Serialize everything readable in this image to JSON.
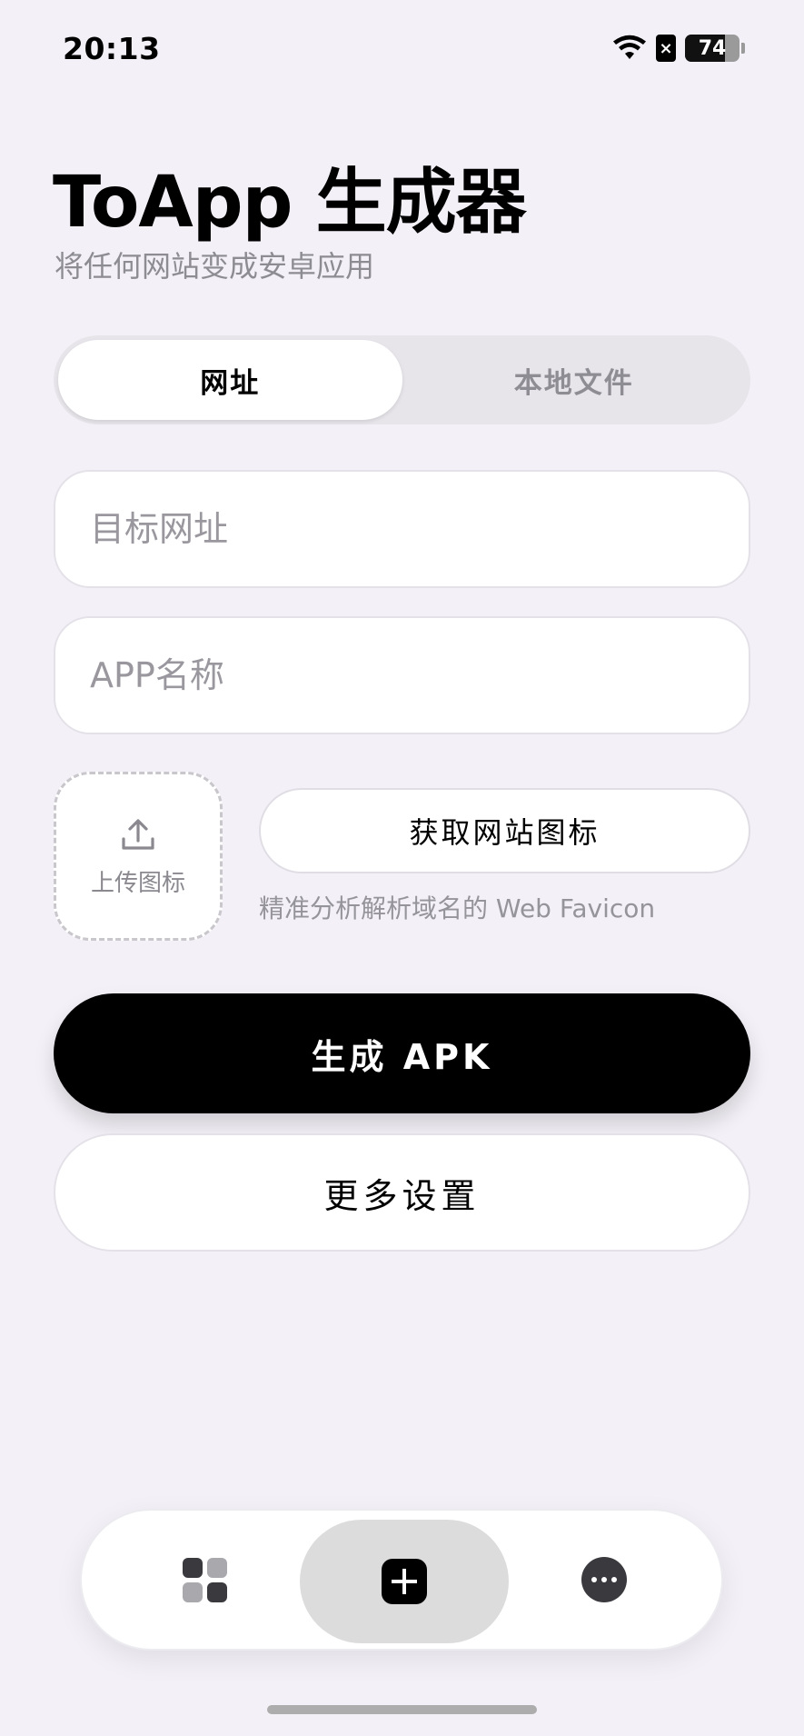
{
  "status_bar": {
    "time": "20:13",
    "battery_level": "74",
    "battery_fraction": 0.74,
    "icons": [
      "wifi-icon",
      "no-sim-icon",
      "battery-icon"
    ]
  },
  "header": {
    "title": "ToApp 生成器",
    "subtitle": "将任何网站变成安卓应用"
  },
  "segmented": {
    "tabs": [
      {
        "label": "网址",
        "active": true
      },
      {
        "label": "本地文件",
        "active": false
      }
    ]
  },
  "form": {
    "url_placeholder": "目标网址",
    "name_placeholder": "APP名称",
    "upload_label": "上传图标",
    "fetch_label": "获取网站图标",
    "fetch_hint": "精准分析解析域名的 Web Favicon"
  },
  "actions": {
    "generate_label": "生成 APK",
    "more_label": "更多设置"
  },
  "bottom_nav": {
    "items": [
      {
        "icon": "grid-icon",
        "active": false
      },
      {
        "icon": "add-icon",
        "active": true
      },
      {
        "icon": "more-icon",
        "active": false
      }
    ]
  },
  "colors": {
    "background": "#f3f1f7",
    "primary": "#000000",
    "muted_text": "#8e8c93"
  }
}
